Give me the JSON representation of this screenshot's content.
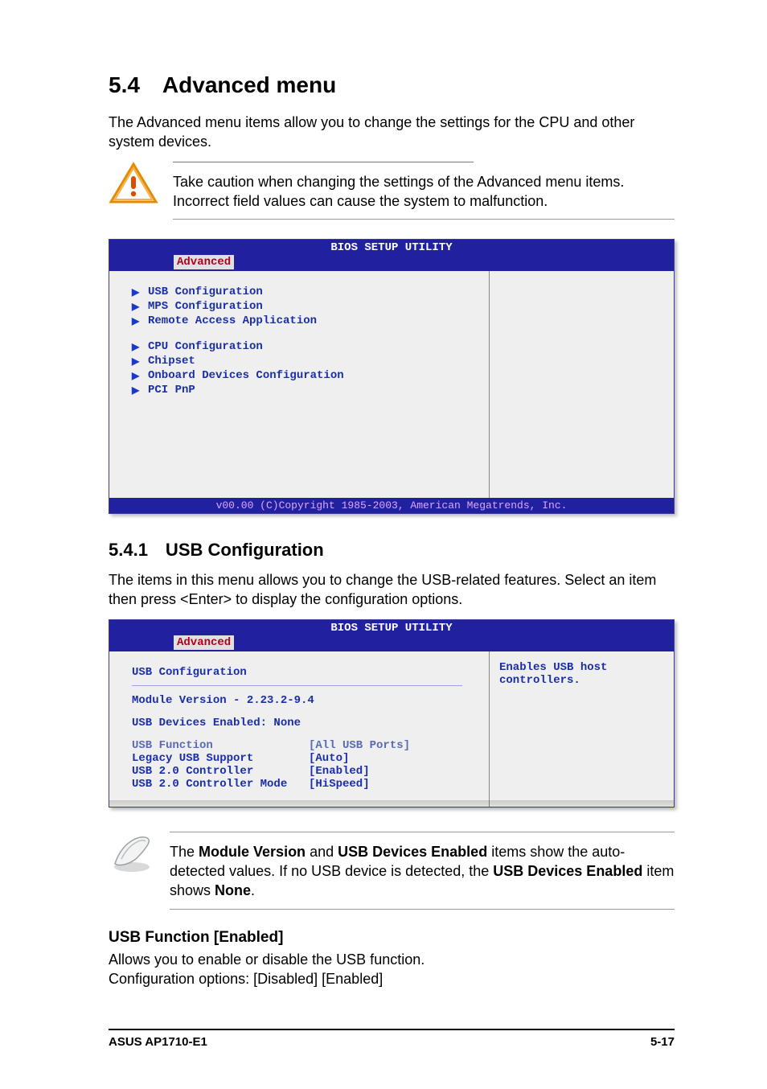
{
  "section": {
    "heading": "5.4 Advanced menu",
    "intro": "The Advanced menu items allow you to change the settings for the CPU and other system devices."
  },
  "caution": {
    "text": "Take caution when changing the settings of the Advanced menu items. Incorrect field values can cause the system to malfunction."
  },
  "bios1": {
    "title": "BIOS SETUP UTILITY",
    "tab": "Advanced",
    "group1": [
      "USB Configuration",
      "MPS Configuration",
      "Remote Access Application"
    ],
    "group2": [
      "CPU Configuration",
      "Chipset",
      "Onboard Devices Configuration",
      "PCI PnP"
    ],
    "footer": "v00.00 (C)Copyright 1985-2003, American Megatrends, Inc."
  },
  "sub": {
    "heading": "5.4.1 USB Configuration",
    "intro": "The items in this menu allows you to change the USB-related features. Select an item then press <Enter> to display the configuration options."
  },
  "bios2": {
    "title": "BIOS SETUP UTILITY",
    "tab": "Advanced",
    "header": "USB Configuration",
    "module": "Module Version - 2.23.2-9.4",
    "devices": "USB Devices Enabled: None",
    "rows": [
      {
        "label": "USB Function",
        "value": "[All USB Ports]"
      },
      {
        "label": "Legacy USB Support",
        "value": "[Auto]"
      },
      {
        "label": "USB 2.0 Controller",
        "value": "[Enabled]"
      },
      {
        "label": "USB 2.0 Controller Mode",
        "value": "[HiSpeed]"
      }
    ],
    "help": "Enables USB host controllers."
  },
  "note": {
    "pre": "The ",
    "b1": "Module Version",
    "mid1": " and ",
    "b2": "USB Devices Enabled",
    "mid2": " items show the auto-detected values. If no USB device is detected, the ",
    "b3": "USB Devices Enabled",
    "mid3": " item shows ",
    "b4": "None",
    "post": "."
  },
  "item": {
    "heading": "USB Function [Enabled]",
    "line1": "Allows you to enable or disable the USB function.",
    "line2": "Configuration options: [Disabled] [Enabled]"
  },
  "footer": {
    "left": "ASUS AP1710-E1",
    "right": "5-17"
  }
}
